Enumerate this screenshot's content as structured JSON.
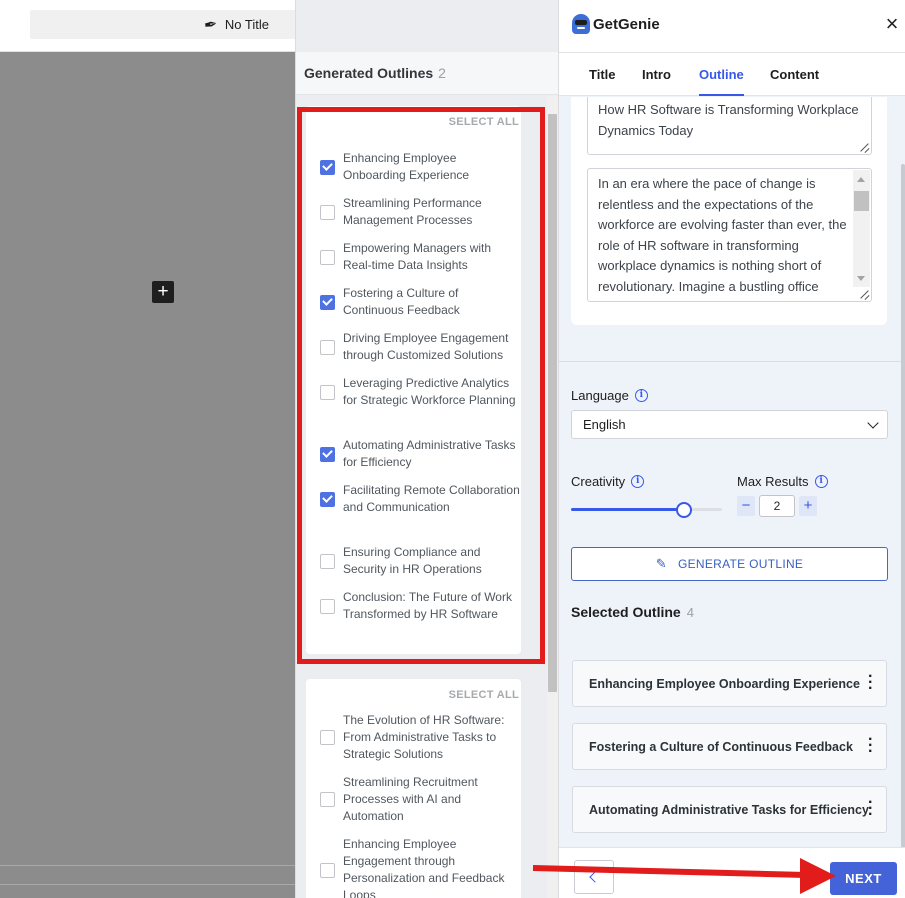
{
  "editor": {
    "title_placeholder": "No Title",
    "add_block_symbol": "+"
  },
  "outlines_panel": {
    "heading": "Generated Outlines",
    "count": "2",
    "groups": [
      {
        "select_all": "SELECT ALL",
        "items": [
          {
            "text": "Enhancing Employee Onboarding Experience",
            "checked": true
          },
          {
            "text": "Streamlining Performance Management Processes",
            "checked": false
          },
          {
            "text": "Empowering Managers with Real-time Data Insights",
            "checked": false
          },
          {
            "text": "Fostering a Culture of Continuous Feedback",
            "checked": true
          },
          {
            "text": "Driving Employee Engagement through Customized Solutions",
            "checked": false
          },
          {
            "text": "Leveraging Predictive Analytics for Strategic Workforce Planning",
            "checked": false
          },
          {
            "text": "Automating Administrative Tasks for Efficiency",
            "checked": true
          },
          {
            "text": "Facilitating Remote Collaboration and Communication",
            "checked": true
          },
          {
            "text": "Ensuring Compliance and Security in HR Operations",
            "checked": false
          },
          {
            "text": "Conclusion: The Future of Work Transformed by HR Software",
            "checked": false
          }
        ]
      },
      {
        "select_all": "SELECT ALL",
        "items": [
          {
            "text": "The Evolution of HR Software: From Administrative Tasks to Strategic Solutions",
            "checked": false
          },
          {
            "text": "Streamlining Recruitment Processes with AI and Automation",
            "checked": false
          },
          {
            "text": "Enhancing Employee Engagement through Personalization and Feedback Loops",
            "checked": false
          }
        ]
      }
    ]
  },
  "plugin": {
    "brand": "GetGenie",
    "close_symbol": "×",
    "tabs": [
      "Title",
      "Intro",
      "Outline",
      "Content"
    ],
    "active_tab": "Outline",
    "title_value": "How HR Software is Transforming Workplace Dynamics Today",
    "intro_value": "In an era where the pace of change is relentless and the expectations of the workforce are evolving faster than ever, the role of HR software in transforming workplace dynamics is nothing short of revolutionary. Imagine a bustling office",
    "language_label": "Language",
    "language_value": "English",
    "creativity_label": "Creativity",
    "creativity_level": 0.75,
    "max_results_label": "Max Results",
    "max_results_value": "2",
    "minus_symbol": "−",
    "plus_symbol": "+",
    "info_symbol": "i",
    "generate_button": "GENERATE OUTLINE",
    "selected_heading": "Selected Outline",
    "selected_count": "4",
    "selected_items": [
      "Enhancing Employee Onboarding Experience",
      "Fostering a Culture of Continuous Feedback",
      "Automating Administrative Tasks for Efficiency"
    ],
    "next_button": "NEXT"
  },
  "colors": {
    "accent": "#3858e9",
    "annotation_red": "#e21b1b",
    "next_bg": "#4563d8"
  },
  "icons": [
    "feather-icon",
    "plus-icon",
    "getgenie-logo-icon",
    "close-icon",
    "info-icon",
    "chevron-down-icon",
    "pencil-icon",
    "kebab-menu-icon",
    "back-arrow-icon"
  ]
}
